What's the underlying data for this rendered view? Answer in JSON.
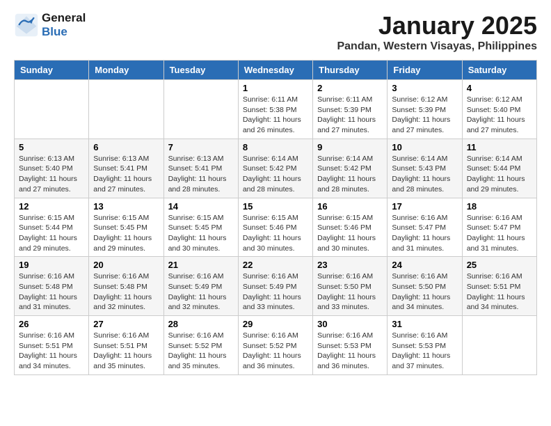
{
  "header": {
    "logo_line1": "General",
    "logo_line2": "Blue",
    "month_title": "January 2025",
    "location": "Pandan, Western Visayas, Philippines"
  },
  "weekdays": [
    "Sunday",
    "Monday",
    "Tuesday",
    "Wednesday",
    "Thursday",
    "Friday",
    "Saturday"
  ],
  "weeks": [
    [
      {
        "day": "",
        "sunrise": "",
        "sunset": "",
        "daylight": ""
      },
      {
        "day": "",
        "sunrise": "",
        "sunset": "",
        "daylight": ""
      },
      {
        "day": "",
        "sunrise": "",
        "sunset": "",
        "daylight": ""
      },
      {
        "day": "1",
        "sunrise": "Sunrise: 6:11 AM",
        "sunset": "Sunset: 5:38 PM",
        "daylight": "Daylight: 11 hours and 26 minutes."
      },
      {
        "day": "2",
        "sunrise": "Sunrise: 6:11 AM",
        "sunset": "Sunset: 5:39 PM",
        "daylight": "Daylight: 11 hours and 27 minutes."
      },
      {
        "day": "3",
        "sunrise": "Sunrise: 6:12 AM",
        "sunset": "Sunset: 5:39 PM",
        "daylight": "Daylight: 11 hours and 27 minutes."
      },
      {
        "day": "4",
        "sunrise": "Sunrise: 6:12 AM",
        "sunset": "Sunset: 5:40 PM",
        "daylight": "Daylight: 11 hours and 27 minutes."
      }
    ],
    [
      {
        "day": "5",
        "sunrise": "Sunrise: 6:13 AM",
        "sunset": "Sunset: 5:40 PM",
        "daylight": "Daylight: 11 hours and 27 minutes."
      },
      {
        "day": "6",
        "sunrise": "Sunrise: 6:13 AM",
        "sunset": "Sunset: 5:41 PM",
        "daylight": "Daylight: 11 hours and 27 minutes."
      },
      {
        "day": "7",
        "sunrise": "Sunrise: 6:13 AM",
        "sunset": "Sunset: 5:41 PM",
        "daylight": "Daylight: 11 hours and 28 minutes."
      },
      {
        "day": "8",
        "sunrise": "Sunrise: 6:14 AM",
        "sunset": "Sunset: 5:42 PM",
        "daylight": "Daylight: 11 hours and 28 minutes."
      },
      {
        "day": "9",
        "sunrise": "Sunrise: 6:14 AM",
        "sunset": "Sunset: 5:42 PM",
        "daylight": "Daylight: 11 hours and 28 minutes."
      },
      {
        "day": "10",
        "sunrise": "Sunrise: 6:14 AM",
        "sunset": "Sunset: 5:43 PM",
        "daylight": "Daylight: 11 hours and 28 minutes."
      },
      {
        "day": "11",
        "sunrise": "Sunrise: 6:14 AM",
        "sunset": "Sunset: 5:44 PM",
        "daylight": "Daylight: 11 hours and 29 minutes."
      }
    ],
    [
      {
        "day": "12",
        "sunrise": "Sunrise: 6:15 AM",
        "sunset": "Sunset: 5:44 PM",
        "daylight": "Daylight: 11 hours and 29 minutes."
      },
      {
        "day": "13",
        "sunrise": "Sunrise: 6:15 AM",
        "sunset": "Sunset: 5:45 PM",
        "daylight": "Daylight: 11 hours and 29 minutes."
      },
      {
        "day": "14",
        "sunrise": "Sunrise: 6:15 AM",
        "sunset": "Sunset: 5:45 PM",
        "daylight": "Daylight: 11 hours and 30 minutes."
      },
      {
        "day": "15",
        "sunrise": "Sunrise: 6:15 AM",
        "sunset": "Sunset: 5:46 PM",
        "daylight": "Daylight: 11 hours and 30 minutes."
      },
      {
        "day": "16",
        "sunrise": "Sunrise: 6:15 AM",
        "sunset": "Sunset: 5:46 PM",
        "daylight": "Daylight: 11 hours and 30 minutes."
      },
      {
        "day": "17",
        "sunrise": "Sunrise: 6:16 AM",
        "sunset": "Sunset: 5:47 PM",
        "daylight": "Daylight: 11 hours and 31 minutes."
      },
      {
        "day": "18",
        "sunrise": "Sunrise: 6:16 AM",
        "sunset": "Sunset: 5:47 PM",
        "daylight": "Daylight: 11 hours and 31 minutes."
      }
    ],
    [
      {
        "day": "19",
        "sunrise": "Sunrise: 6:16 AM",
        "sunset": "Sunset: 5:48 PM",
        "daylight": "Daylight: 11 hours and 31 minutes."
      },
      {
        "day": "20",
        "sunrise": "Sunrise: 6:16 AM",
        "sunset": "Sunset: 5:48 PM",
        "daylight": "Daylight: 11 hours and 32 minutes."
      },
      {
        "day": "21",
        "sunrise": "Sunrise: 6:16 AM",
        "sunset": "Sunset: 5:49 PM",
        "daylight": "Daylight: 11 hours and 32 minutes."
      },
      {
        "day": "22",
        "sunrise": "Sunrise: 6:16 AM",
        "sunset": "Sunset: 5:49 PM",
        "daylight": "Daylight: 11 hours and 33 minutes."
      },
      {
        "day": "23",
        "sunrise": "Sunrise: 6:16 AM",
        "sunset": "Sunset: 5:50 PM",
        "daylight": "Daylight: 11 hours and 33 minutes."
      },
      {
        "day": "24",
        "sunrise": "Sunrise: 6:16 AM",
        "sunset": "Sunset: 5:50 PM",
        "daylight": "Daylight: 11 hours and 34 minutes."
      },
      {
        "day": "25",
        "sunrise": "Sunrise: 6:16 AM",
        "sunset": "Sunset: 5:51 PM",
        "daylight": "Daylight: 11 hours and 34 minutes."
      }
    ],
    [
      {
        "day": "26",
        "sunrise": "Sunrise: 6:16 AM",
        "sunset": "Sunset: 5:51 PM",
        "daylight": "Daylight: 11 hours and 34 minutes."
      },
      {
        "day": "27",
        "sunrise": "Sunrise: 6:16 AM",
        "sunset": "Sunset: 5:51 PM",
        "daylight": "Daylight: 11 hours and 35 minutes."
      },
      {
        "day": "28",
        "sunrise": "Sunrise: 6:16 AM",
        "sunset": "Sunset: 5:52 PM",
        "daylight": "Daylight: 11 hours and 35 minutes."
      },
      {
        "day": "29",
        "sunrise": "Sunrise: 6:16 AM",
        "sunset": "Sunset: 5:52 PM",
        "daylight": "Daylight: 11 hours and 36 minutes."
      },
      {
        "day": "30",
        "sunrise": "Sunrise: 6:16 AM",
        "sunset": "Sunset: 5:53 PM",
        "daylight": "Daylight: 11 hours and 36 minutes."
      },
      {
        "day": "31",
        "sunrise": "Sunrise: 6:16 AM",
        "sunset": "Sunset: 5:53 PM",
        "daylight": "Daylight: 11 hours and 37 minutes."
      },
      {
        "day": "",
        "sunrise": "",
        "sunset": "",
        "daylight": ""
      }
    ]
  ]
}
